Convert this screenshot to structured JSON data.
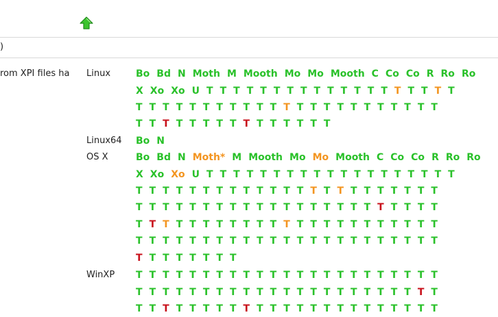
{
  "header": {
    "up_icon": "up-arrow-icon",
    "subtitle": ")",
    "description": "rom XPI files ha"
  },
  "colors": {
    "ok": "#2ac12a",
    "warn": "#f39521",
    "fail": "#c8111b"
  },
  "platforms": [
    {
      "name": "Linux",
      "lines": [
        [
          [
            "Bo",
            "ok"
          ],
          [
            "Bd",
            "ok"
          ],
          [
            "N",
            "ok"
          ],
          [
            "Moth",
            "ok"
          ],
          [
            "M",
            "ok"
          ],
          [
            "Mooth",
            "ok"
          ],
          [
            "Mo",
            "ok"
          ],
          [
            "Mo",
            "ok"
          ],
          [
            "Mooth",
            "ok"
          ],
          [
            "C",
            "ok"
          ],
          [
            "Co",
            "ok"
          ],
          [
            "Co",
            "ok"
          ],
          [
            "R",
            "ok"
          ],
          [
            "Ro",
            "ok"
          ],
          [
            "Ro",
            "ok"
          ]
        ],
        [
          [
            "X",
            "ok"
          ],
          [
            "Xo",
            "ok"
          ],
          [
            "Xo",
            "ok"
          ],
          [
            "U",
            "ok"
          ],
          [
            "T",
            "ok"
          ],
          [
            "T",
            "ok"
          ],
          [
            "T",
            "ok"
          ],
          [
            "T",
            "ok"
          ],
          [
            "T",
            "ok"
          ],
          [
            "T",
            "ok"
          ],
          [
            "T",
            "ok"
          ],
          [
            "T",
            "ok"
          ],
          [
            "T",
            "ok"
          ],
          [
            "T",
            "ok"
          ],
          [
            "T",
            "ok"
          ],
          [
            "T",
            "ok"
          ],
          [
            "T",
            "ok"
          ],
          [
            "T",
            "ok"
          ],
          [
            "T",
            "warn"
          ],
          [
            "T",
            "ok"
          ],
          [
            "T",
            "ok"
          ],
          [
            "T",
            "warn"
          ],
          [
            "T",
            "ok"
          ]
        ],
        [
          [
            "T",
            "ok"
          ],
          [
            "T",
            "ok"
          ],
          [
            "T",
            "ok"
          ],
          [
            "T",
            "ok"
          ],
          [
            "T",
            "ok"
          ],
          [
            "T",
            "ok"
          ],
          [
            "T",
            "ok"
          ],
          [
            "T",
            "ok"
          ],
          [
            "T",
            "ok"
          ],
          [
            "T",
            "ok"
          ],
          [
            "T",
            "ok"
          ],
          [
            "T",
            "warn"
          ],
          [
            "T",
            "ok"
          ],
          [
            "T",
            "ok"
          ],
          [
            "T",
            "ok"
          ],
          [
            "T",
            "ok"
          ],
          [
            "T",
            "ok"
          ],
          [
            "T",
            "ok"
          ],
          [
            "T",
            "ok"
          ],
          [
            "T",
            "ok"
          ],
          [
            "T",
            "ok"
          ],
          [
            "T",
            "ok"
          ],
          [
            "T",
            "ok"
          ]
        ],
        [
          [
            "T",
            "ok"
          ],
          [
            "T",
            "ok"
          ],
          [
            "T",
            "fail"
          ],
          [
            "T",
            "ok"
          ],
          [
            "T",
            "ok"
          ],
          [
            "T",
            "ok"
          ],
          [
            "T",
            "ok"
          ],
          [
            "T",
            "ok"
          ],
          [
            "T",
            "fail"
          ],
          [
            "T",
            "ok"
          ],
          [
            "T",
            "ok"
          ],
          [
            "T",
            "ok"
          ],
          [
            "T",
            "ok"
          ],
          [
            "T",
            "ok"
          ],
          [
            "T",
            "ok"
          ]
        ]
      ]
    },
    {
      "name": "Linux64",
      "lines": [
        [
          [
            "Bo",
            "ok"
          ],
          [
            "N",
            "ok"
          ]
        ]
      ]
    },
    {
      "name": "OS X",
      "lines": [
        [
          [
            "Bo",
            "ok"
          ],
          [
            "Bd",
            "ok"
          ],
          [
            "N",
            "ok"
          ],
          [
            "Moth*",
            "warn"
          ],
          [
            "M",
            "ok"
          ],
          [
            "Mooth",
            "ok"
          ],
          [
            "Mo",
            "ok"
          ],
          [
            "Mo",
            "warn"
          ],
          [
            "Mooth",
            "ok"
          ],
          [
            "C",
            "ok"
          ],
          [
            "Co",
            "ok"
          ],
          [
            "Co",
            "ok"
          ],
          [
            "R",
            "ok"
          ],
          [
            "Ro",
            "ok"
          ],
          [
            "Ro",
            "ok"
          ]
        ],
        [
          [
            "X",
            "ok"
          ],
          [
            "Xo",
            "ok"
          ],
          [
            "Xo",
            "warn"
          ],
          [
            "U",
            "ok"
          ],
          [
            "T",
            "ok"
          ],
          [
            "T",
            "ok"
          ],
          [
            "T",
            "ok"
          ],
          [
            "T",
            "ok"
          ],
          [
            "T",
            "ok"
          ],
          [
            "T",
            "ok"
          ],
          [
            "T",
            "ok"
          ],
          [
            "T",
            "ok"
          ],
          [
            "T",
            "ok"
          ],
          [
            "T",
            "ok"
          ],
          [
            "T",
            "ok"
          ],
          [
            "T",
            "ok"
          ],
          [
            "T",
            "ok"
          ],
          [
            "T",
            "ok"
          ],
          [
            "T",
            "ok"
          ],
          [
            "T",
            "ok"
          ],
          [
            "T",
            "ok"
          ],
          [
            "T",
            "ok"
          ],
          [
            "T",
            "ok"
          ]
        ],
        [
          [
            "T",
            "ok"
          ],
          [
            "T",
            "ok"
          ],
          [
            "T",
            "ok"
          ],
          [
            "T",
            "ok"
          ],
          [
            "T",
            "ok"
          ],
          [
            "T",
            "ok"
          ],
          [
            "T",
            "ok"
          ],
          [
            "T",
            "ok"
          ],
          [
            "T",
            "ok"
          ],
          [
            "T",
            "ok"
          ],
          [
            "T",
            "ok"
          ],
          [
            "T",
            "ok"
          ],
          [
            "T",
            "ok"
          ],
          [
            "T",
            "warn"
          ],
          [
            "T",
            "ok"
          ],
          [
            "T",
            "warn"
          ],
          [
            "T",
            "ok"
          ],
          [
            "T",
            "ok"
          ],
          [
            "T",
            "ok"
          ],
          [
            "T",
            "ok"
          ],
          [
            "T",
            "ok"
          ],
          [
            "T",
            "ok"
          ],
          [
            "T",
            "ok"
          ]
        ],
        [
          [
            "T",
            "ok"
          ],
          [
            "T",
            "ok"
          ],
          [
            "T",
            "ok"
          ],
          [
            "T",
            "ok"
          ],
          [
            "T",
            "ok"
          ],
          [
            "T",
            "ok"
          ],
          [
            "T",
            "ok"
          ],
          [
            "T",
            "ok"
          ],
          [
            "T",
            "ok"
          ],
          [
            "T",
            "ok"
          ],
          [
            "T",
            "ok"
          ],
          [
            "T",
            "ok"
          ],
          [
            "T",
            "ok"
          ],
          [
            "T",
            "ok"
          ],
          [
            "T",
            "ok"
          ],
          [
            "T",
            "ok"
          ],
          [
            "T",
            "ok"
          ],
          [
            "T",
            "ok"
          ],
          [
            "T",
            "fail"
          ],
          [
            "T",
            "ok"
          ],
          [
            "T",
            "ok"
          ],
          [
            "T",
            "ok"
          ],
          [
            "T",
            "ok"
          ]
        ],
        [
          [
            "T",
            "ok"
          ],
          [
            "T",
            "fail"
          ],
          [
            "T",
            "warn"
          ],
          [
            "T",
            "ok"
          ],
          [
            "T",
            "ok"
          ],
          [
            "T",
            "ok"
          ],
          [
            "T",
            "ok"
          ],
          [
            "T",
            "ok"
          ],
          [
            "T",
            "ok"
          ],
          [
            "T",
            "ok"
          ],
          [
            "T",
            "ok"
          ],
          [
            "T",
            "warn"
          ],
          [
            "T",
            "ok"
          ],
          [
            "T",
            "ok"
          ],
          [
            "T",
            "ok"
          ],
          [
            "T",
            "ok"
          ],
          [
            "T",
            "ok"
          ],
          [
            "T",
            "ok"
          ],
          [
            "T",
            "ok"
          ],
          [
            "T",
            "ok"
          ],
          [
            "T",
            "ok"
          ],
          [
            "T",
            "ok"
          ],
          [
            "T",
            "ok"
          ]
        ],
        [
          [
            "T",
            "ok"
          ],
          [
            "T",
            "ok"
          ],
          [
            "T",
            "ok"
          ],
          [
            "T",
            "ok"
          ],
          [
            "T",
            "ok"
          ],
          [
            "T",
            "ok"
          ],
          [
            "T",
            "ok"
          ],
          [
            "T",
            "ok"
          ],
          [
            "T",
            "ok"
          ],
          [
            "T",
            "ok"
          ],
          [
            "T",
            "ok"
          ],
          [
            "T",
            "ok"
          ],
          [
            "T",
            "ok"
          ],
          [
            "T",
            "ok"
          ],
          [
            "T",
            "ok"
          ],
          [
            "T",
            "ok"
          ],
          [
            "T",
            "ok"
          ],
          [
            "T",
            "ok"
          ],
          [
            "T",
            "ok"
          ],
          [
            "T",
            "ok"
          ],
          [
            "T",
            "ok"
          ],
          [
            "T",
            "ok"
          ],
          [
            "T",
            "ok"
          ]
        ],
        [
          [
            "T",
            "fail"
          ],
          [
            "T",
            "ok"
          ],
          [
            "T",
            "ok"
          ],
          [
            "T",
            "ok"
          ],
          [
            "T",
            "ok"
          ],
          [
            "T",
            "ok"
          ],
          [
            "T",
            "ok"
          ],
          [
            "T",
            "ok"
          ]
        ]
      ]
    },
    {
      "name": "WinXP",
      "lines": [
        [
          [
            "T",
            "ok"
          ],
          [
            "T",
            "ok"
          ],
          [
            "T",
            "ok"
          ],
          [
            "T",
            "ok"
          ],
          [
            "T",
            "ok"
          ],
          [
            "T",
            "ok"
          ],
          [
            "T",
            "ok"
          ],
          [
            "T",
            "ok"
          ],
          [
            "T",
            "ok"
          ],
          [
            "T",
            "ok"
          ],
          [
            "T",
            "ok"
          ],
          [
            "T",
            "ok"
          ],
          [
            "T",
            "ok"
          ],
          [
            "T",
            "ok"
          ],
          [
            "T",
            "ok"
          ],
          [
            "T",
            "ok"
          ],
          [
            "T",
            "ok"
          ],
          [
            "T",
            "ok"
          ],
          [
            "T",
            "ok"
          ],
          [
            "T",
            "ok"
          ],
          [
            "T",
            "ok"
          ],
          [
            "T",
            "ok"
          ],
          [
            "T",
            "ok"
          ]
        ],
        [
          [
            "T",
            "ok"
          ],
          [
            "T",
            "ok"
          ],
          [
            "T",
            "ok"
          ],
          [
            "T",
            "ok"
          ],
          [
            "T",
            "ok"
          ],
          [
            "T",
            "ok"
          ],
          [
            "T",
            "ok"
          ],
          [
            "T",
            "ok"
          ],
          [
            "T",
            "ok"
          ],
          [
            "T",
            "ok"
          ],
          [
            "T",
            "ok"
          ],
          [
            "T",
            "ok"
          ],
          [
            "T",
            "ok"
          ],
          [
            "T",
            "ok"
          ],
          [
            "T",
            "ok"
          ],
          [
            "T",
            "ok"
          ],
          [
            "T",
            "ok"
          ],
          [
            "T",
            "ok"
          ],
          [
            "T",
            "ok"
          ],
          [
            "T",
            "ok"
          ],
          [
            "T",
            "ok"
          ],
          [
            "T",
            "fail"
          ],
          [
            "T",
            "ok"
          ]
        ],
        [
          [
            "T",
            "ok"
          ],
          [
            "T",
            "ok"
          ],
          [
            "T",
            "fail"
          ],
          [
            "T",
            "ok"
          ],
          [
            "T",
            "ok"
          ],
          [
            "T",
            "ok"
          ],
          [
            "T",
            "ok"
          ],
          [
            "T",
            "ok"
          ],
          [
            "T",
            "fail"
          ],
          [
            "T",
            "ok"
          ],
          [
            "T",
            "ok"
          ],
          [
            "T",
            "ok"
          ],
          [
            "T",
            "ok"
          ],
          [
            "T",
            "ok"
          ],
          [
            "T",
            "ok"
          ],
          [
            "T",
            "ok"
          ],
          [
            "T",
            "ok"
          ],
          [
            "T",
            "ok"
          ],
          [
            "T",
            "ok"
          ],
          [
            "T",
            "ok"
          ],
          [
            "T",
            "ok"
          ],
          [
            "T",
            "ok"
          ],
          [
            "T",
            "ok"
          ]
        ]
      ]
    }
  ]
}
